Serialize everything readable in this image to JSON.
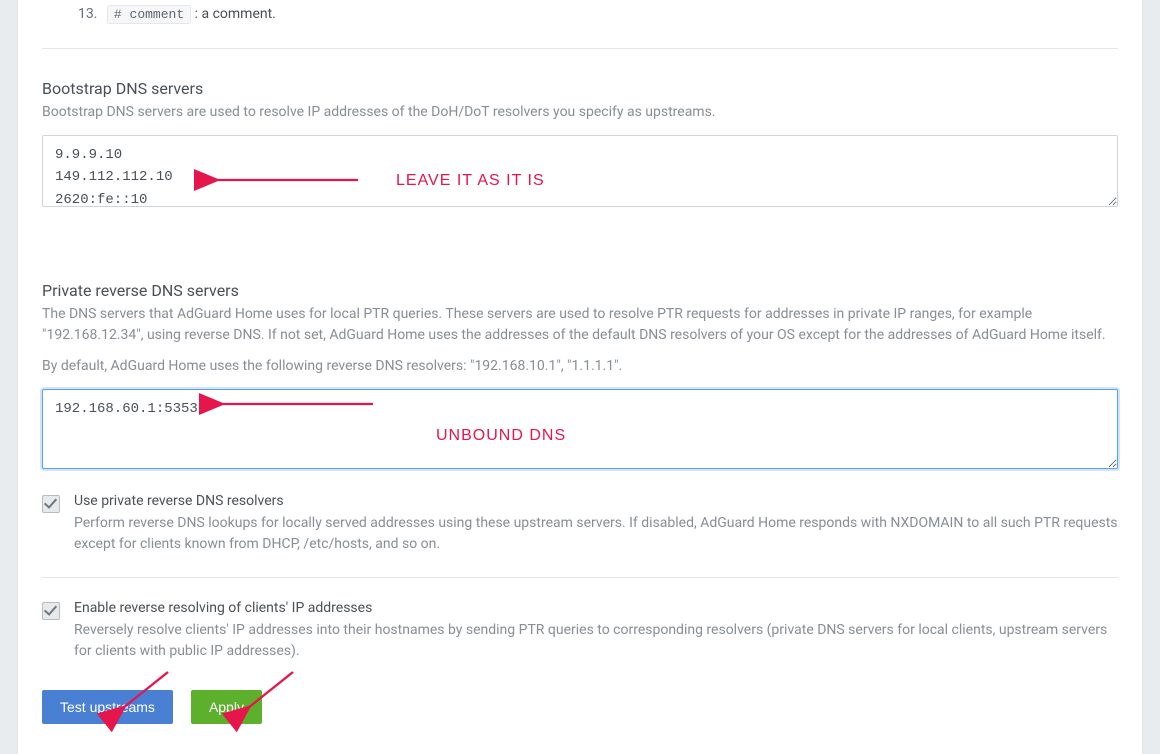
{
  "list13": {
    "number": "13.",
    "code": "# comment",
    "text": ": a comment."
  },
  "bootstrap": {
    "title": "Bootstrap DNS servers",
    "desc": "Bootstrap DNS servers are used to resolve IP addresses of the DoH/DoT resolvers you specify as upstreams.",
    "value": "9.9.9.10\n149.112.112.10\n2620:fe::10"
  },
  "privateReverse": {
    "title": "Private reverse DNS servers",
    "desc": "The DNS servers that AdGuard Home uses for local PTR queries. These servers are used to resolve PTR requests for addresses in private IP ranges, for example \"192.168.12.34\", using reverse DNS. If not set, AdGuard Home uses the addresses of the default DNS resolvers of your OS except for the addresses of AdGuard Home itself.",
    "default_note": "By default, AdGuard Home uses the following reverse DNS resolvers: \"192.168.10.1\", \"1.1.1.1\".",
    "value": "192.168.60.1:5353"
  },
  "chk1": {
    "label": "Use private reverse DNS resolvers",
    "desc": "Perform reverse DNS lookups for locally served addresses using these upstream servers. If disabled, AdGuard Home responds with NXDOMAIN to all such PTR requests except for clients known from DHCP, /etc/hosts, and so on."
  },
  "chk2": {
    "label": "Enable reverse resolving of clients' IP addresses",
    "desc": "Reversely resolve clients' IP addresses into their hostnames by sending PTR queries to corresponding resolvers (private DNS servers for local clients, upstream servers for clients with public IP addresses)."
  },
  "buttons": {
    "test": "Test upstreams",
    "apply": "Apply"
  },
  "annot": {
    "leave": "LEAVE IT AS IT IS",
    "unbound": "UNBOUND DNS"
  },
  "colors": {
    "annotation": "#e6154c",
    "primary": "#4a80d4",
    "success": "#5cb02c"
  }
}
